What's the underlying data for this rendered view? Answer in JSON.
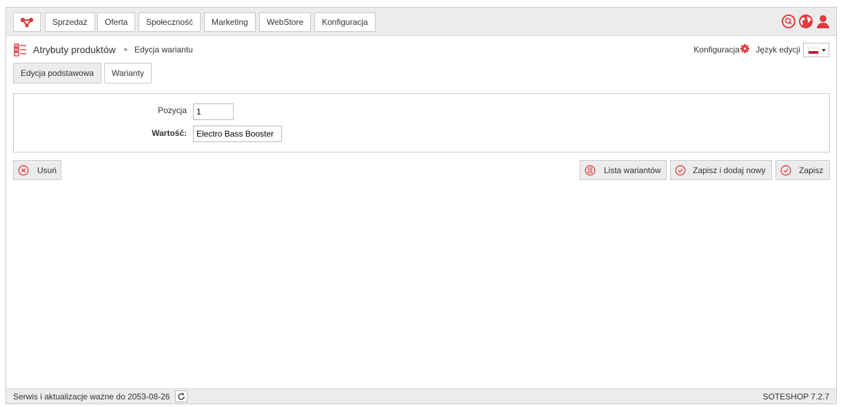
{
  "colors": {
    "accent": "#e2393c",
    "panel_bg": "#ececec",
    "border": "#c9c9c9"
  },
  "nav": {
    "logo_icon": "sote-logo-icon",
    "items": [
      "Sprzedaż",
      "Oferta",
      "Społeczność",
      "Marketing",
      "WebStore",
      "Konfiguracja"
    ],
    "right_icons": [
      "search-icon",
      "globe-icon",
      "user-icon"
    ]
  },
  "breadcrumb": {
    "icon": "product-attributes-icon",
    "title": "Atrybuty produktów",
    "separator": "►",
    "current": "Edycja wariantu"
  },
  "header_right": {
    "config_label": "Konfiguracja",
    "config_icon": "gear-icon",
    "language_label": "Język edycji",
    "language_flag": "poland-flag"
  },
  "tabs": [
    "Edycja podstawowa",
    "Warianty"
  ],
  "form": {
    "position_label": "Pozycja",
    "position_value": "1",
    "value_label": "Wartość:",
    "value_value": "Electro Bass Booster"
  },
  "actions": {
    "delete_label": "Usuń",
    "list_label": "Lista wariantów",
    "save_add_label": "Zapisz i dodaj nowy",
    "save_label": "Zapisz"
  },
  "footer": {
    "service_text": "Serwis i aktualizacje ważne do 2053-08-26",
    "version": "SOTESHOP 7.2.7"
  }
}
